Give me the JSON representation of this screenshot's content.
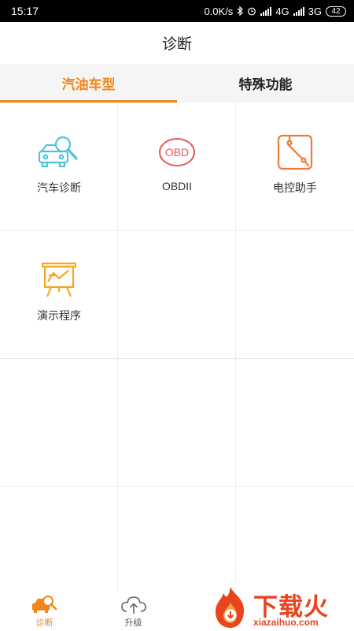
{
  "status_bar": {
    "time": "15:17",
    "speed": "0.0K/s",
    "net1": "4G",
    "net2": "3G",
    "battery": "42"
  },
  "header": {
    "title": "诊断"
  },
  "tabs": [
    {
      "label": "汽油车型",
      "active": true
    },
    {
      "label": "特殊功能",
      "active": false
    }
  ],
  "grid": {
    "items": [
      {
        "label": "汽车诊断",
        "icon": "car-search-icon",
        "color": "#4fc3d9"
      },
      {
        "label": "OBDII",
        "icon": "obd-icon",
        "color": "#e8585a"
      },
      {
        "label": "电控助手",
        "icon": "ecu-assistant-icon",
        "color": "#f07a3a"
      },
      {
        "label": "演示程序",
        "icon": "demo-board-icon",
        "color": "#f5a623"
      }
    ]
  },
  "bottom_nav": [
    {
      "label": "诊断",
      "icon": "diagnosis-car-icon",
      "active": true
    },
    {
      "label": "升级",
      "icon": "cloud-upgrade-icon",
      "active": false
    }
  ],
  "watermark": {
    "text": "下载火",
    "url": "xiazaihuo.com"
  },
  "colors": {
    "accent": "#f08519",
    "divider": "#ececec"
  }
}
